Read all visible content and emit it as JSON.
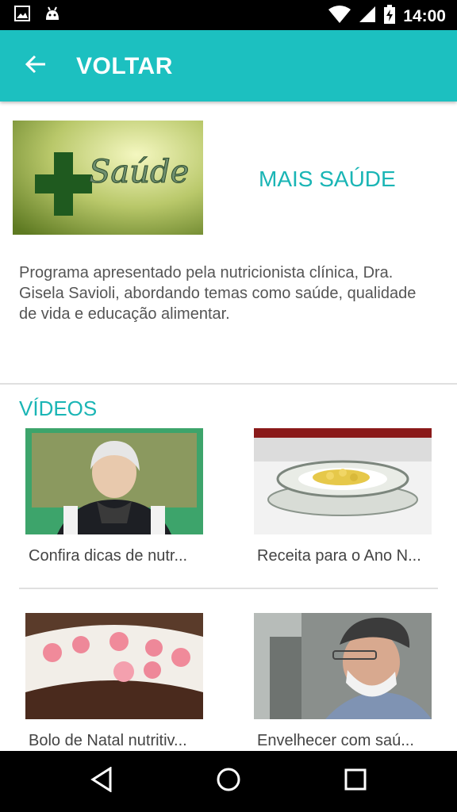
{
  "status_bar": {
    "time": "14:00",
    "icons": [
      "image-icon",
      "android-icon",
      "wifi-icon",
      "signal-icon",
      "battery-charging-icon"
    ]
  },
  "app_bar": {
    "back_icon": "arrow-left-icon",
    "title": "VOLTAR"
  },
  "program": {
    "name": "MAIS SAÚDE",
    "description": "Programa apresentado pela nutricionista clínica, Dra. Gisela Savioli, abordando temas como saúde, qualidade de vida e educação alimentar."
  },
  "videos": {
    "title": "VÍDEOS",
    "items": [
      {
        "title": "Confira dicas de nutr..."
      },
      {
        "title": "Receita para o Ano N..."
      },
      {
        "title": "Bolo de Natal nutritiv..."
      },
      {
        "title": "Envelhecer com saú..."
      }
    ]
  },
  "nav_bar": {
    "icons": [
      "back-triangle-icon",
      "home-circle-icon",
      "recents-square-icon"
    ]
  },
  "colors": {
    "accent": "#1cc0c0",
    "accent_text": "#1ab5b5"
  }
}
